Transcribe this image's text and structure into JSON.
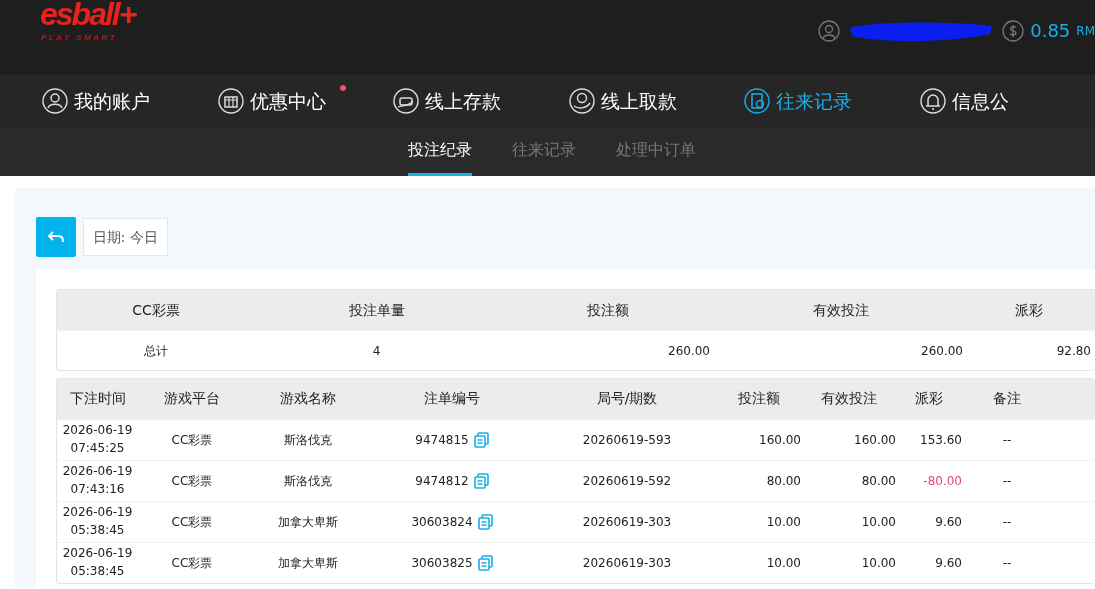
{
  "header": {
    "logo": "esball+",
    "tagline": "PLAY SMART",
    "balance": "0.85",
    "currency": "RM"
  },
  "nav": [
    {
      "label": "我的账户",
      "selected": false,
      "notify": false
    },
    {
      "label": "优惠中心",
      "selected": false,
      "notify": true
    },
    {
      "label": "线上存款",
      "selected": false,
      "notify": false
    },
    {
      "label": "线上取款",
      "selected": false,
      "notify": false
    },
    {
      "label": "往来记录",
      "selected": true,
      "notify": false
    },
    {
      "label": "信息公",
      "selected": false,
      "notify": false
    }
  ],
  "sub_tabs": [
    {
      "label": "投注纪录",
      "selected": true
    },
    {
      "label": "往来记录",
      "selected": false
    },
    {
      "label": "处理中订单",
      "selected": false
    }
  ],
  "filter": {
    "date": "日期: 今日"
  },
  "summary": {
    "columns": [
      "CC彩票",
      "投注单量",
      "投注额",
      "有效投注",
      "派彩"
    ],
    "rows": [
      [
        "总计",
        "4",
        "260.00",
        "260.00",
        "92.80"
      ]
    ]
  },
  "table": {
    "columns": [
      "下注时间",
      "游戏平台",
      "游戏名称",
      "注单编号",
      "局号/期数",
      "投注额",
      "有效投注",
      "派彩",
      "备注"
    ],
    "rows": [
      {
        "date": "2026-06-19",
        "time": "07:45:25",
        "platform": "CC彩票",
        "game": "斯洛伐克",
        "ticket": "9474815",
        "round": "20260619-593",
        "bet": "160.00",
        "valid": "160.00",
        "payout": "153.60",
        "negative": false,
        "note": "--"
      },
      {
        "date": "2026-06-19",
        "time": "07:43:16",
        "platform": "CC彩票",
        "game": "斯洛伐克",
        "ticket": "9474812",
        "round": "20260619-592",
        "bet": "80.00",
        "valid": "80.00",
        "payout": "-80.00",
        "negative": true,
        "note": "--"
      },
      {
        "date": "2026-06-19",
        "time": "05:38:45",
        "platform": "CC彩票",
        "game": "加拿大卑斯",
        "ticket": "30603824",
        "round": "20260619-303",
        "bet": "10.00",
        "valid": "10.00",
        "payout": "9.60",
        "negative": false,
        "note": "--"
      },
      {
        "date": "2026-06-19",
        "time": "05:38:45",
        "platform": "CC彩票",
        "game": "加拿大卑斯",
        "ticket": "30603825",
        "round": "20260619-303",
        "bet": "10.00",
        "valid": "10.00",
        "payout": "9.60",
        "negative": false,
        "note": "--"
      }
    ]
  }
}
